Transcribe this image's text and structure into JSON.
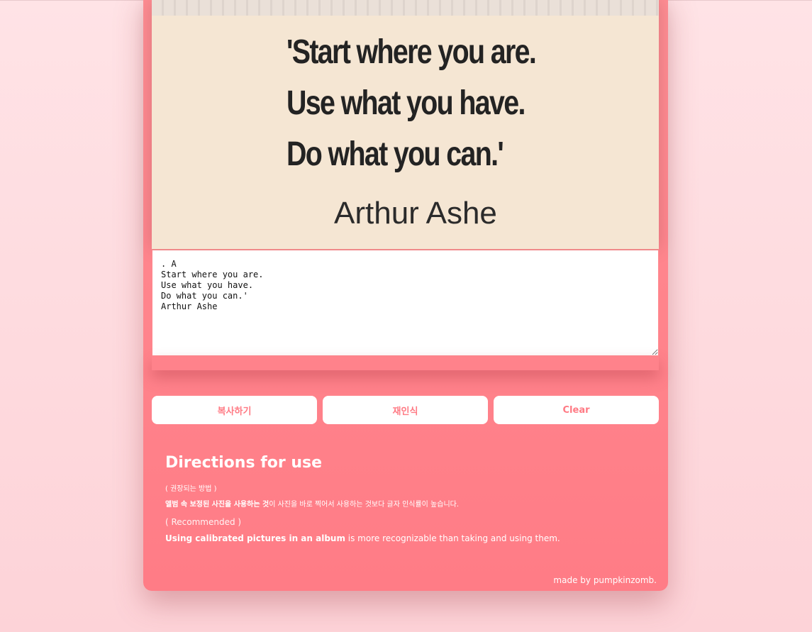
{
  "image": {
    "quote_lines": [
      "'Start where you are.",
      "Use what you have.",
      "Do what you can.'"
    ],
    "author": "Arthur Ashe"
  },
  "ocr": {
    "text": ". A\nStart where you are.\nUse what you have.\nDo what you can.'\nArthur Ashe"
  },
  "buttons": {
    "copy_label": "복사하기",
    "retry_label": "재인식",
    "clear_label": "Clear"
  },
  "directions": {
    "title": "Directions for use",
    "ko_recommended": "( 권장되는 방법 )",
    "ko_desc_bold": "앨범 속 보정된 사진을 사용하는 것",
    "ko_desc_rest": "이 사진을 바로 찍어서 사용하는 것보다 글자 인식률이 높습니다.",
    "en_recommended": "( Recommended )",
    "en_desc_bold": "Using calibrated pictures in an album",
    "en_desc_rest": " is more recognizable than taking and using them."
  },
  "footer": {
    "credit": "made by pumpkinzomb."
  },
  "colors": {
    "accent": "#ff7c86",
    "page_background": "#ffe3e6",
    "image_background": "#f5e6d3"
  }
}
